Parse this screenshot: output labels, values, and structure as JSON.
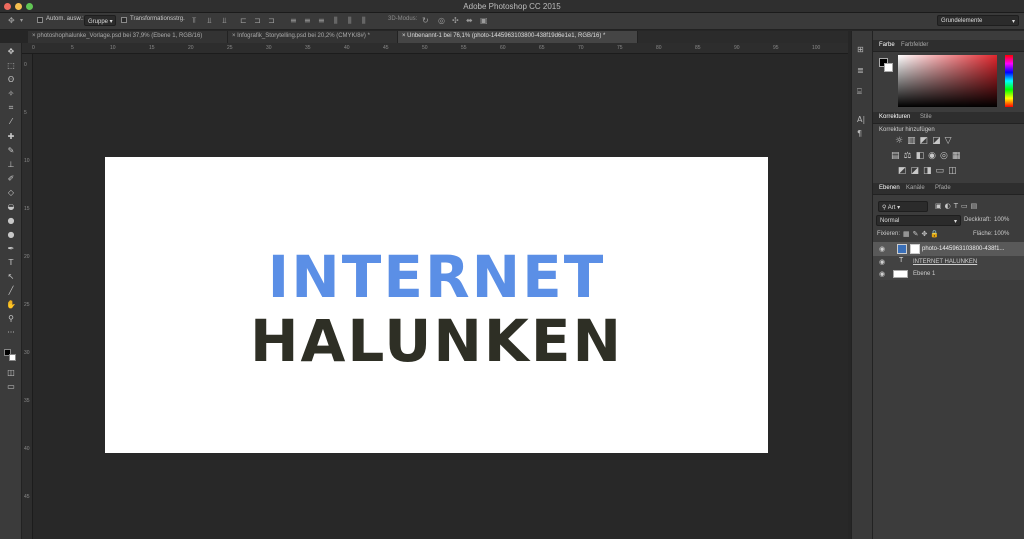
{
  "window": {
    "title": "Adobe Photoshop CC 2015"
  },
  "options_bar": {
    "auto_select_label": "Autom. ausw.:",
    "auto_select_value": "Gruppe",
    "transform_controls_label": "Transformationsstrg.",
    "mode_3d_label": "3D-Modus:",
    "workspace_value": "Grundelemente"
  },
  "tabs": [
    {
      "label": "photoshophalunke_Vorlage.psd bei 37,9% (Ebene 1, RGB/16)"
    },
    {
      "label": "Infografik_Storytelling.psd bei 20,2% (CMYK/8#) *"
    },
    {
      "label": "Unbenannt-1 bei 76,1% (photo-1445963103800-438f19d6e1e1, RGB/16) *"
    }
  ],
  "ruler": {
    "h": [
      "0",
      "5",
      "10",
      "15",
      "20",
      "25",
      "30",
      "35",
      "40",
      "45",
      "50",
      "55",
      "60",
      "65",
      "70",
      "75",
      "80",
      "85",
      "90",
      "95",
      "100"
    ],
    "v": [
      "0",
      "5",
      "10",
      "15",
      "20",
      "25",
      "30",
      "35",
      "40",
      "45"
    ]
  },
  "canvas": {
    "line1": "INTERNET",
    "line2": "HALUNKEN",
    "line1_color": "#5b8fe6",
    "line2_color": "#2e2f25"
  },
  "color_panel": {
    "tab_active": "Farbe",
    "tab2": "Farbfelder",
    "hue_color": "#e0262d"
  },
  "adjustments_panel": {
    "tab_active": "Korrekturen",
    "tab2": "Stile",
    "heading": "Korrektur hinzufügen"
  },
  "layers_panel": {
    "tabs": [
      "Ebenen",
      "Kanäle",
      "Pfade"
    ],
    "filter_value": "Art",
    "blend_mode": "Normal",
    "opacity_label": "Deckkraft:",
    "opacity_value": "100%",
    "lock_label": "Fixieren:",
    "fill_label": "Fläche:",
    "fill_value": "100%",
    "layers": [
      {
        "name": "photo-1445963103800-438f1...",
        "kind": "smart"
      },
      {
        "name": "INTERNET HALUNKEN",
        "kind": "text"
      },
      {
        "name": "Ebene 1",
        "kind": "pixel"
      }
    ]
  }
}
